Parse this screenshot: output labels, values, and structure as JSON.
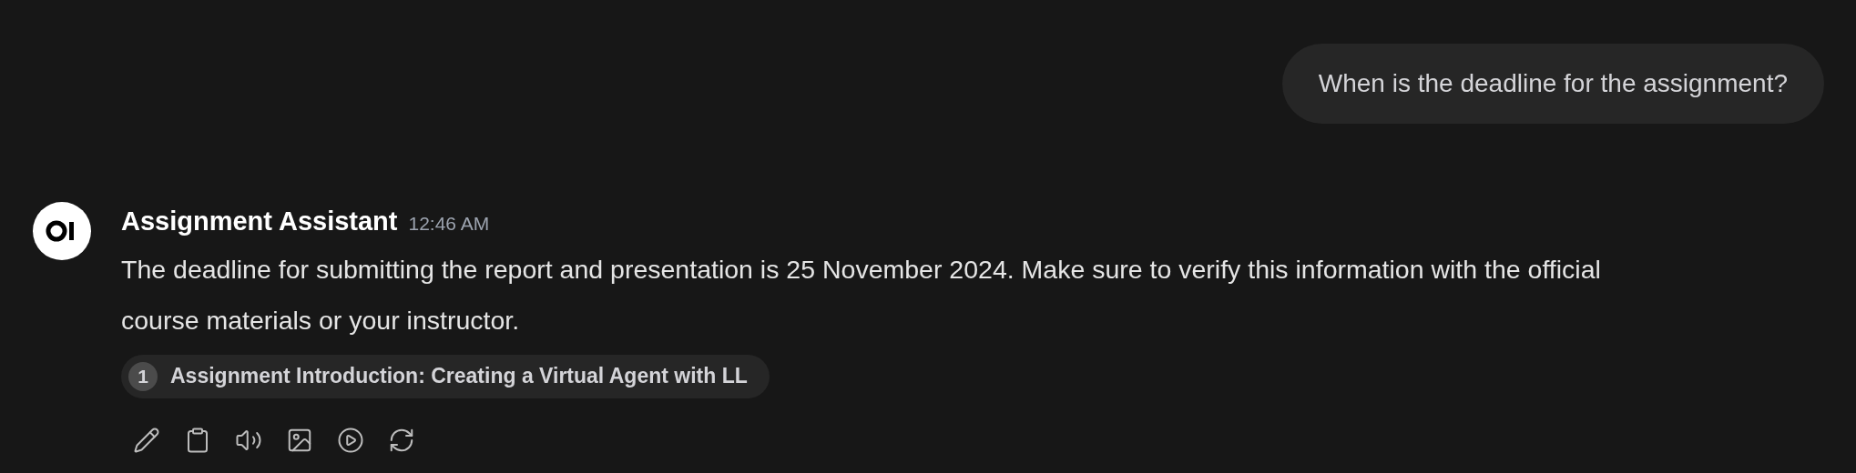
{
  "user_message": {
    "text": "When is the deadline for the assignment?"
  },
  "assistant_message": {
    "name": "Assignment Assistant",
    "time": "12:46 AM",
    "text": "The deadline for submitting the report and presentation is 25 November 2024. Make sure to verify this information with the official course materials or your instructor.",
    "citations": [
      {
        "index": "1",
        "title": "Assignment Introduction: Creating a Virtual Agent with LL"
      }
    ],
    "actions": [
      {
        "kind": "edit"
      },
      {
        "kind": "copy"
      },
      {
        "kind": "speak"
      },
      {
        "kind": "image"
      },
      {
        "kind": "play"
      },
      {
        "kind": "regenerate"
      }
    ]
  }
}
